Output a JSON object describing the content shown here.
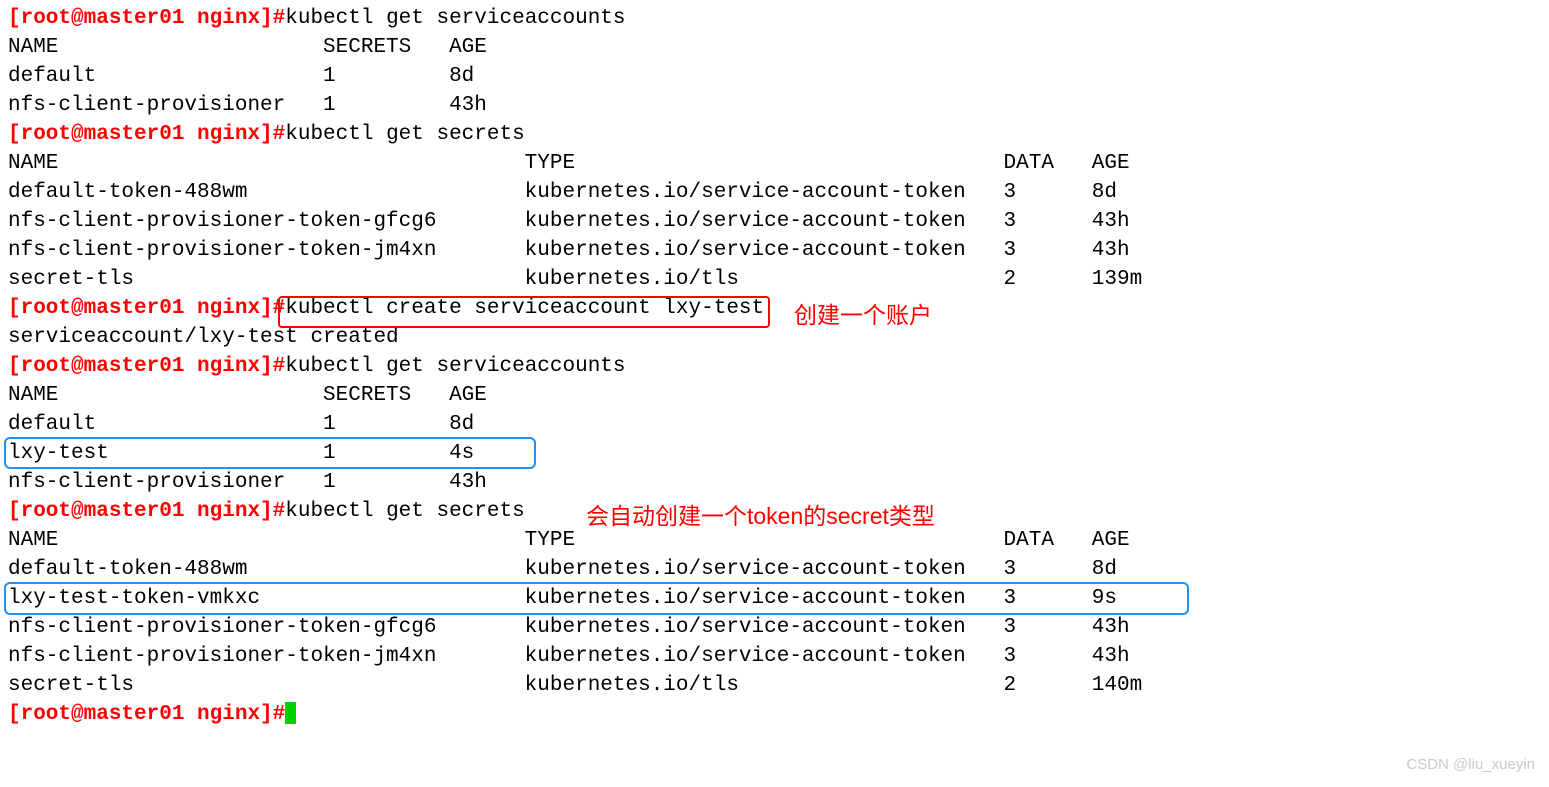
{
  "prompt": "[root@master01 nginx]#",
  "cmd": {
    "get_sa": "kubectl get serviceaccounts",
    "get_secrets": "kubectl get secrets",
    "create_sa": "kubectl create serviceaccount lxy-test"
  },
  "sa1_hdr": "NAME                     SECRETS   AGE",
  "sa1_r1": "default                  1         8d",
  "sa1_r2": "nfs-client-provisioner   1         43h",
  "sec1_hdr": "NAME                                     TYPE                                  DATA   AGE",
  "sec1_r1": "default-token-488wm                      kubernetes.io/service-account-token   3      8d",
  "sec1_r2": "nfs-client-provisioner-token-gfcg6       kubernetes.io/service-account-token   3      43h",
  "sec1_r3": "nfs-client-provisioner-token-jm4xn       kubernetes.io/service-account-token   3      43h",
  "sec1_r4": "secret-tls                               kubernetes.io/tls                     2      139m",
  "create_out": "serviceaccount/lxy-test created",
  "sa2_hdr": "NAME                     SECRETS   AGE",
  "sa2_r1": "default                  1         8d",
  "sa2_r2": "lxy-test                 1         4s",
  "sa2_r3": "nfs-client-provisioner   1         43h",
  "sec2_hdr": "NAME                                     TYPE                                  DATA   AGE",
  "sec2_r1": "default-token-488wm                      kubernetes.io/service-account-token   3      8d",
  "sec2_r2": "lxy-test-token-vmkxc                     kubernetes.io/service-account-token   3      9s",
  "sec2_r3": "nfs-client-provisioner-token-gfcg6       kubernetes.io/service-account-token   3      43h",
  "sec2_r4": "nfs-client-provisioner-token-jm4xn       kubernetes.io/service-account-token   3      43h",
  "sec2_r5": "secret-tls                               kubernetes.io/tls                     2      140m",
  "annot": {
    "create": "创建一个账户",
    "auto_token": "会自动创建一个token的secret类型"
  },
  "watermark": "CSDN @liu_xueyin"
}
